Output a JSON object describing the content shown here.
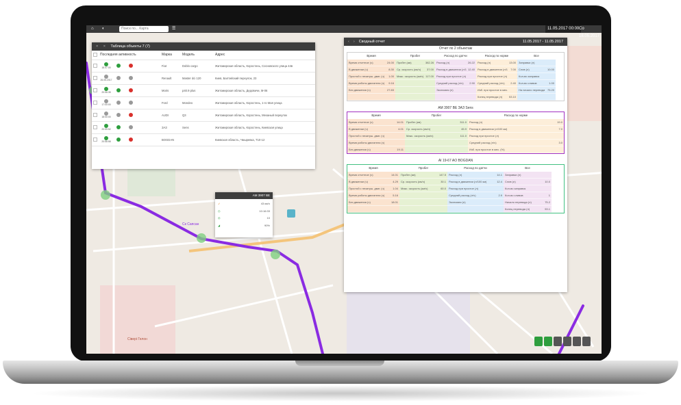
{
  "topbar": {
    "search_placeholder": "Поиск по... Карта",
    "date_from": "11.05.2017 00:00",
    "date_to": "Со 18.05.2017"
  },
  "objects_panel": {
    "title": "Таблица объекты 7 (7)",
    "columns": [
      "Последняя активность",
      "Марка",
      "Модель",
      "Адрес"
    ],
    "rows": [
      {
        "time": "18.07.00",
        "brand": "Fiat",
        "model": "Doblo cargo",
        "address": "Житомирская область, Коростень, Сосновского улица 44в"
      },
      {
        "time": "26.05.2017",
        "brand": "Renault",
        "model": "Master dci 120",
        "address": "Киев, Балтийский переулок, 23"
      },
      {
        "time": "20:56:35",
        "brand": "Moris",
        "model": "p40.9 plus",
        "address": "Житомирская область, Дедовичи, М-06"
      },
      {
        "time": "17:00:00",
        "brand": "Ford",
        "model": "Mondeo",
        "address": "Житомирская область, Коростень, 1-го Мая улица"
      },
      {
        "time": "18:00:00",
        "brand": "AUDI",
        "model": "Q3",
        "address": "Житомирская область, Коростень, Механый переулок"
      },
      {
        "time": "20:59:52",
        "brand": "ЗАЗ",
        "model": "Sens",
        "address": "Житомирская область, Коростень, Киевская улица"
      },
      {
        "time": "20:56:58",
        "brand": "BOGDAN",
        "model": "",
        "address": "Киевская область, Чмыревка, Т10-12"
      }
    ]
  },
  "vehicle_popup": {
    "plate": "AM 3907 BE",
    "speed": "43 км/ч",
    "time": "10:16:33",
    "value1": "10",
    "value2": "90%"
  },
  "report": {
    "header_title": "Сводный отчет",
    "header_dates": "11.05.2017 - 11.05.2017",
    "section1": {
      "title": "Отчет по 2 объектам",
      "columns": [
        "Время",
        "Пробег",
        "Расход по датчи",
        "Расход по норме",
        "Все"
      ],
      "rows": [
        [
          "Время отчетное (ч)",
          "24.00",
          "Пробег (км)",
          "382.26",
          "Расход (л)",
          "26.22",
          "Расход (л)",
          "13.00",
          "Заправки (л)",
          ""
        ],
        [
          "В движении (ч)",
          "8.30",
          "Ср. скорость (км/ч)",
          "37.00",
          "Расход в движении (л/100 км)",
          "12.40",
          "Расход в движении (л/100 км)",
          "7.00",
          "Слив (л)",
          "10.00"
        ],
        [
          "Простой с незатуш. двиг. (ч)",
          "1.00",
          "Макс. скорость (км/ч)",
          "117.00",
          "Расход при простое (л)",
          "",
          "Расход при простое (л)",
          "",
          "Кол-во заправок",
          ""
        ],
        [
          "Время работы двигателя (ч)",
          "9.16",
          "",
          "",
          "Средний расход (л/ч)",
          "2.90",
          "Средний расход (л/ч)",
          "2.40",
          "Кол-во сливов",
          "1.00"
        ],
        [
          "Без движения (ч)",
          "27.83",
          "",
          "",
          "Экономия (л)",
          "",
          "Изб. при простое в мес. (%)",
          "",
          "На начало перевода (л)",
          "75.20"
        ],
        [
          "",
          "",
          "",
          "",
          "",
          "",
          "Конец перевода (л)",
          "53.10",
          "",
          ""
        ]
      ]
    },
    "section2": {
      "title": "AM 3907 BE ЗАЗ Sens",
      "columns": [
        "Время",
        "Пробег",
        "Расход по норме"
      ],
      "rows": [
        [
          "Время отчетное (ч)",
          "14.01",
          "Пробег (км)",
          "311.0",
          "Расход (л)",
          "19.0"
        ],
        [
          "В движении (ч)",
          "4.01",
          "Ср. скорость (км/ч)",
          "45.9",
          "Расход в движении (л/100 км)",
          "7.0"
        ],
        [
          "Простой с незатуш. двиг. (ч)",
          "",
          "Макс. скорость (км/ч)",
          "111.0",
          "Расход при простое (л)",
          ""
        ],
        [
          "Время работы двигателя (ч)",
          "",
          "",
          "",
          "Средний расход (л/ч)",
          "3.0"
        ],
        [
          "Без движения (ч)",
          "19.11",
          "",
          "",
          "Изб. при простое в мес. (%)",
          ""
        ]
      ]
    },
    "section3": {
      "title": "AI 19-67 AO BOGDAN",
      "columns": [
        "Время",
        "Пробег",
        "Расход по датчи",
        "Все"
      ],
      "rows": [
        [
          "Время отчетное (ч)",
          "14.01",
          "Пробег (км)",
          "147.5",
          "Расход (л)",
          "14.1",
          "Заправки (л)",
          ""
        ],
        [
          "В движении (ч)",
          "4.29",
          "Ср. скорость (км/ч)",
          "30.1",
          "Расход в движении (л/100 км)",
          "12.4",
          "Слив (л)",
          "10.0"
        ],
        [
          "Простой с незатуш. двиг. (ч)",
          "1.04",
          "Макс. скорость (км/ч)",
          "60.0",
          "Расход при простое (л)",
          "",
          "Кол-во заправок",
          ""
        ],
        [
          "Время работы двигателя (ч)",
          "5.16",
          "",
          "",
          "Средний расход (л/ч)",
          "2.9",
          "Кол-во сливов",
          "1"
        ],
        [
          "Без движения (ч)",
          "18.01",
          "",
          "",
          "Экономия (л)",
          "",
          "Начало перевода (л)",
          "75.2"
        ],
        [
          "",
          "",
          "",
          "",
          "",
          "",
          "Конец перевода (л)",
          "53.1"
        ]
      ]
    }
  },
  "map_labels": {
    "poi_1": "Ск Сапсан",
    "poi_2": "Сівері Гелон"
  },
  "colors": {
    "route": "#8a2be2",
    "panel_header": "#3d3d3d",
    "ok_green": "#2e9e3e",
    "alert_red": "#d9302c"
  }
}
